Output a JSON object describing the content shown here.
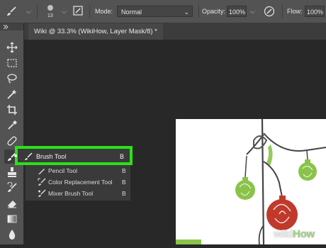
{
  "options_bar": {
    "brush_size": "13",
    "mode_label": "Mode:",
    "mode_value": "Normal",
    "opacity_label": "Opacity:",
    "opacity_value": "100%",
    "flow_label": "Flow:",
    "flow_value": "100%"
  },
  "document_tab": {
    "title": "Wiki @ 33.3% (WikiHow, Layer Mask/8) *"
  },
  "flyout": {
    "items": [
      {
        "label": "Brush Tool",
        "shortcut": "B",
        "icon": "brush-icon",
        "selected": true
      },
      {
        "label": "Pencil Tool",
        "shortcut": "B",
        "icon": "pencil-icon",
        "selected": false
      },
      {
        "label": "Color Replacement Tool",
        "shortcut": "B",
        "icon": "color-replacement-icon",
        "selected": false
      },
      {
        "label": "Mixer Brush Tool",
        "shortcut": "B",
        "icon": "mixer-brush-icon",
        "selected": false
      }
    ]
  },
  "watermark": {
    "wiki": "wiki",
    "how": "How"
  },
  "colors": {
    "highlight": "#2be01a",
    "ornament_red": "#c0392b",
    "ornament_green": "#8bc34a"
  }
}
